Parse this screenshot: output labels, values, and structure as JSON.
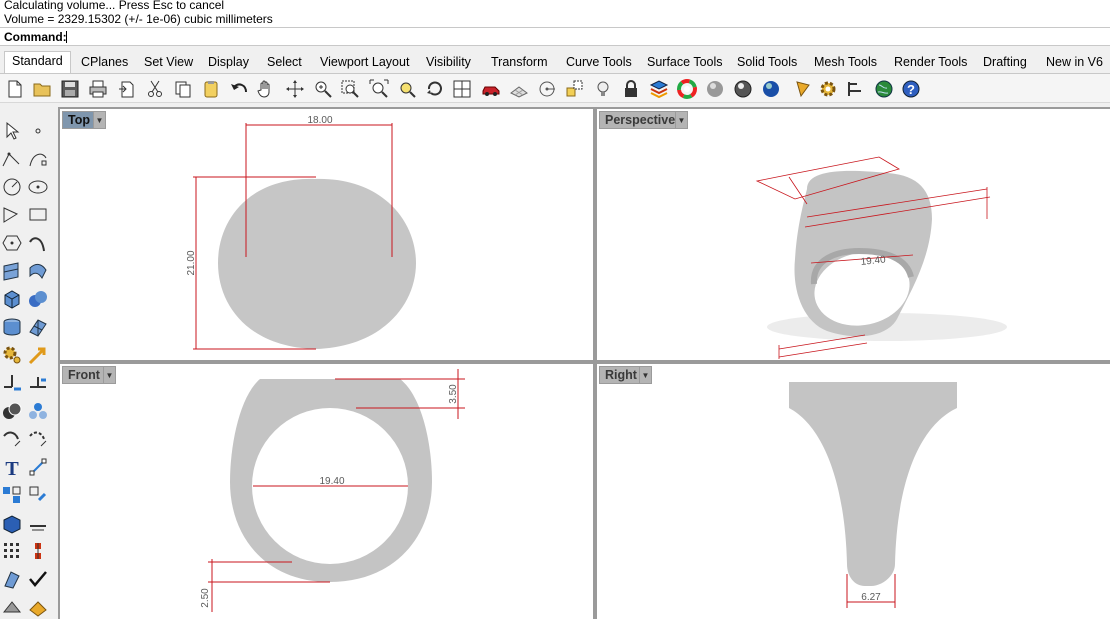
{
  "command_area": {
    "history_line1": "Calculating volume... Press Esc to cancel",
    "history_line2": "Volume = 2329.15302 (+/- 1e-06) cubic millimeters",
    "prompt_label": "Command:",
    "input_value": ""
  },
  "tabs": [
    {
      "label": "Standard",
      "active": true
    },
    {
      "label": "CPlanes"
    },
    {
      "label": "Set View"
    },
    {
      "label": "Display"
    },
    {
      "label": "Select"
    },
    {
      "label": "Viewport Layout"
    },
    {
      "label": "Visibility"
    },
    {
      "label": "Transform"
    },
    {
      "label": "Curve Tools"
    },
    {
      "label": "Surface Tools"
    },
    {
      "label": "Solid Tools"
    },
    {
      "label": "Mesh Tools"
    },
    {
      "label": "Render Tools"
    },
    {
      "label": "Drafting"
    },
    {
      "label": "New in V6"
    }
  ],
  "toolbar_icons": [
    "new-file-icon",
    "open-folder-icon",
    "save-icon",
    "print-icon",
    "import-icon",
    "cut-icon",
    "copy-icon",
    "paste-icon",
    "undo-icon",
    "pan-hand-icon",
    "rotate-view-icon",
    "zoom-icon",
    "zoom-window-icon",
    "zoom-extents-icon",
    "zoom-selected-icon",
    "rotate-camera-icon",
    "viewport-layout-icon",
    "car-render-icon",
    "grid-plane-icon",
    "cplane-icon",
    "transform-icon",
    "light-bulb-icon",
    "lock-icon",
    "layer-icon",
    "color-wheel-icon",
    "shaded-sphere-icon",
    "rendered-sphere-icon",
    "blue-sphere-icon",
    "cone-light-icon",
    "gear-options-icon",
    "align-icon",
    "globe-icon",
    "help-icon"
  ],
  "sidebar_icons": [
    "select-arrow-icon",
    "point-icon",
    "polyline-icon",
    "curve-icon",
    "circle-icon",
    "ellipse-icon",
    "arc-icon",
    "rectangle-icon",
    "polygon-icon",
    "freeform-curve-icon",
    "surface-icon",
    "loft-icon",
    "box-icon",
    "solid-spheres-icon",
    "cylinder-icon",
    "mesh-icon",
    "gear-tools-icon",
    "arrow-tools-icon",
    "explode-icon",
    "trim-icon",
    "boolean-icon",
    "analysis-icon",
    "rotate-icon",
    "scale-icon",
    "text-icon",
    "dimension-icon",
    "array-icon",
    "group-icon",
    "box-solid-icon",
    "flatten-icon",
    "grid-array-icon",
    "gumball-icon",
    "block-icon",
    "check-icon",
    "render-icon",
    "material-icon"
  ],
  "viewports": {
    "top": {
      "title": "Top",
      "dims": {
        "width": "18.00",
        "height": "21.00"
      }
    },
    "perspective": {
      "title": "Perspective",
      "dims": {
        "inner": "19.40"
      }
    },
    "front": {
      "title": "Front",
      "dims": {
        "top_thickness": "3.50",
        "inner_diameter": "19.40",
        "bottom_thickness": "2.50"
      }
    },
    "right": {
      "title": "Right",
      "dims": {
        "bottom_width": "6.27"
      }
    }
  },
  "colors": {
    "dimension_red": "#c8161d",
    "model_gray": "#c4c4c4",
    "active_title": "#7f96ad"
  }
}
